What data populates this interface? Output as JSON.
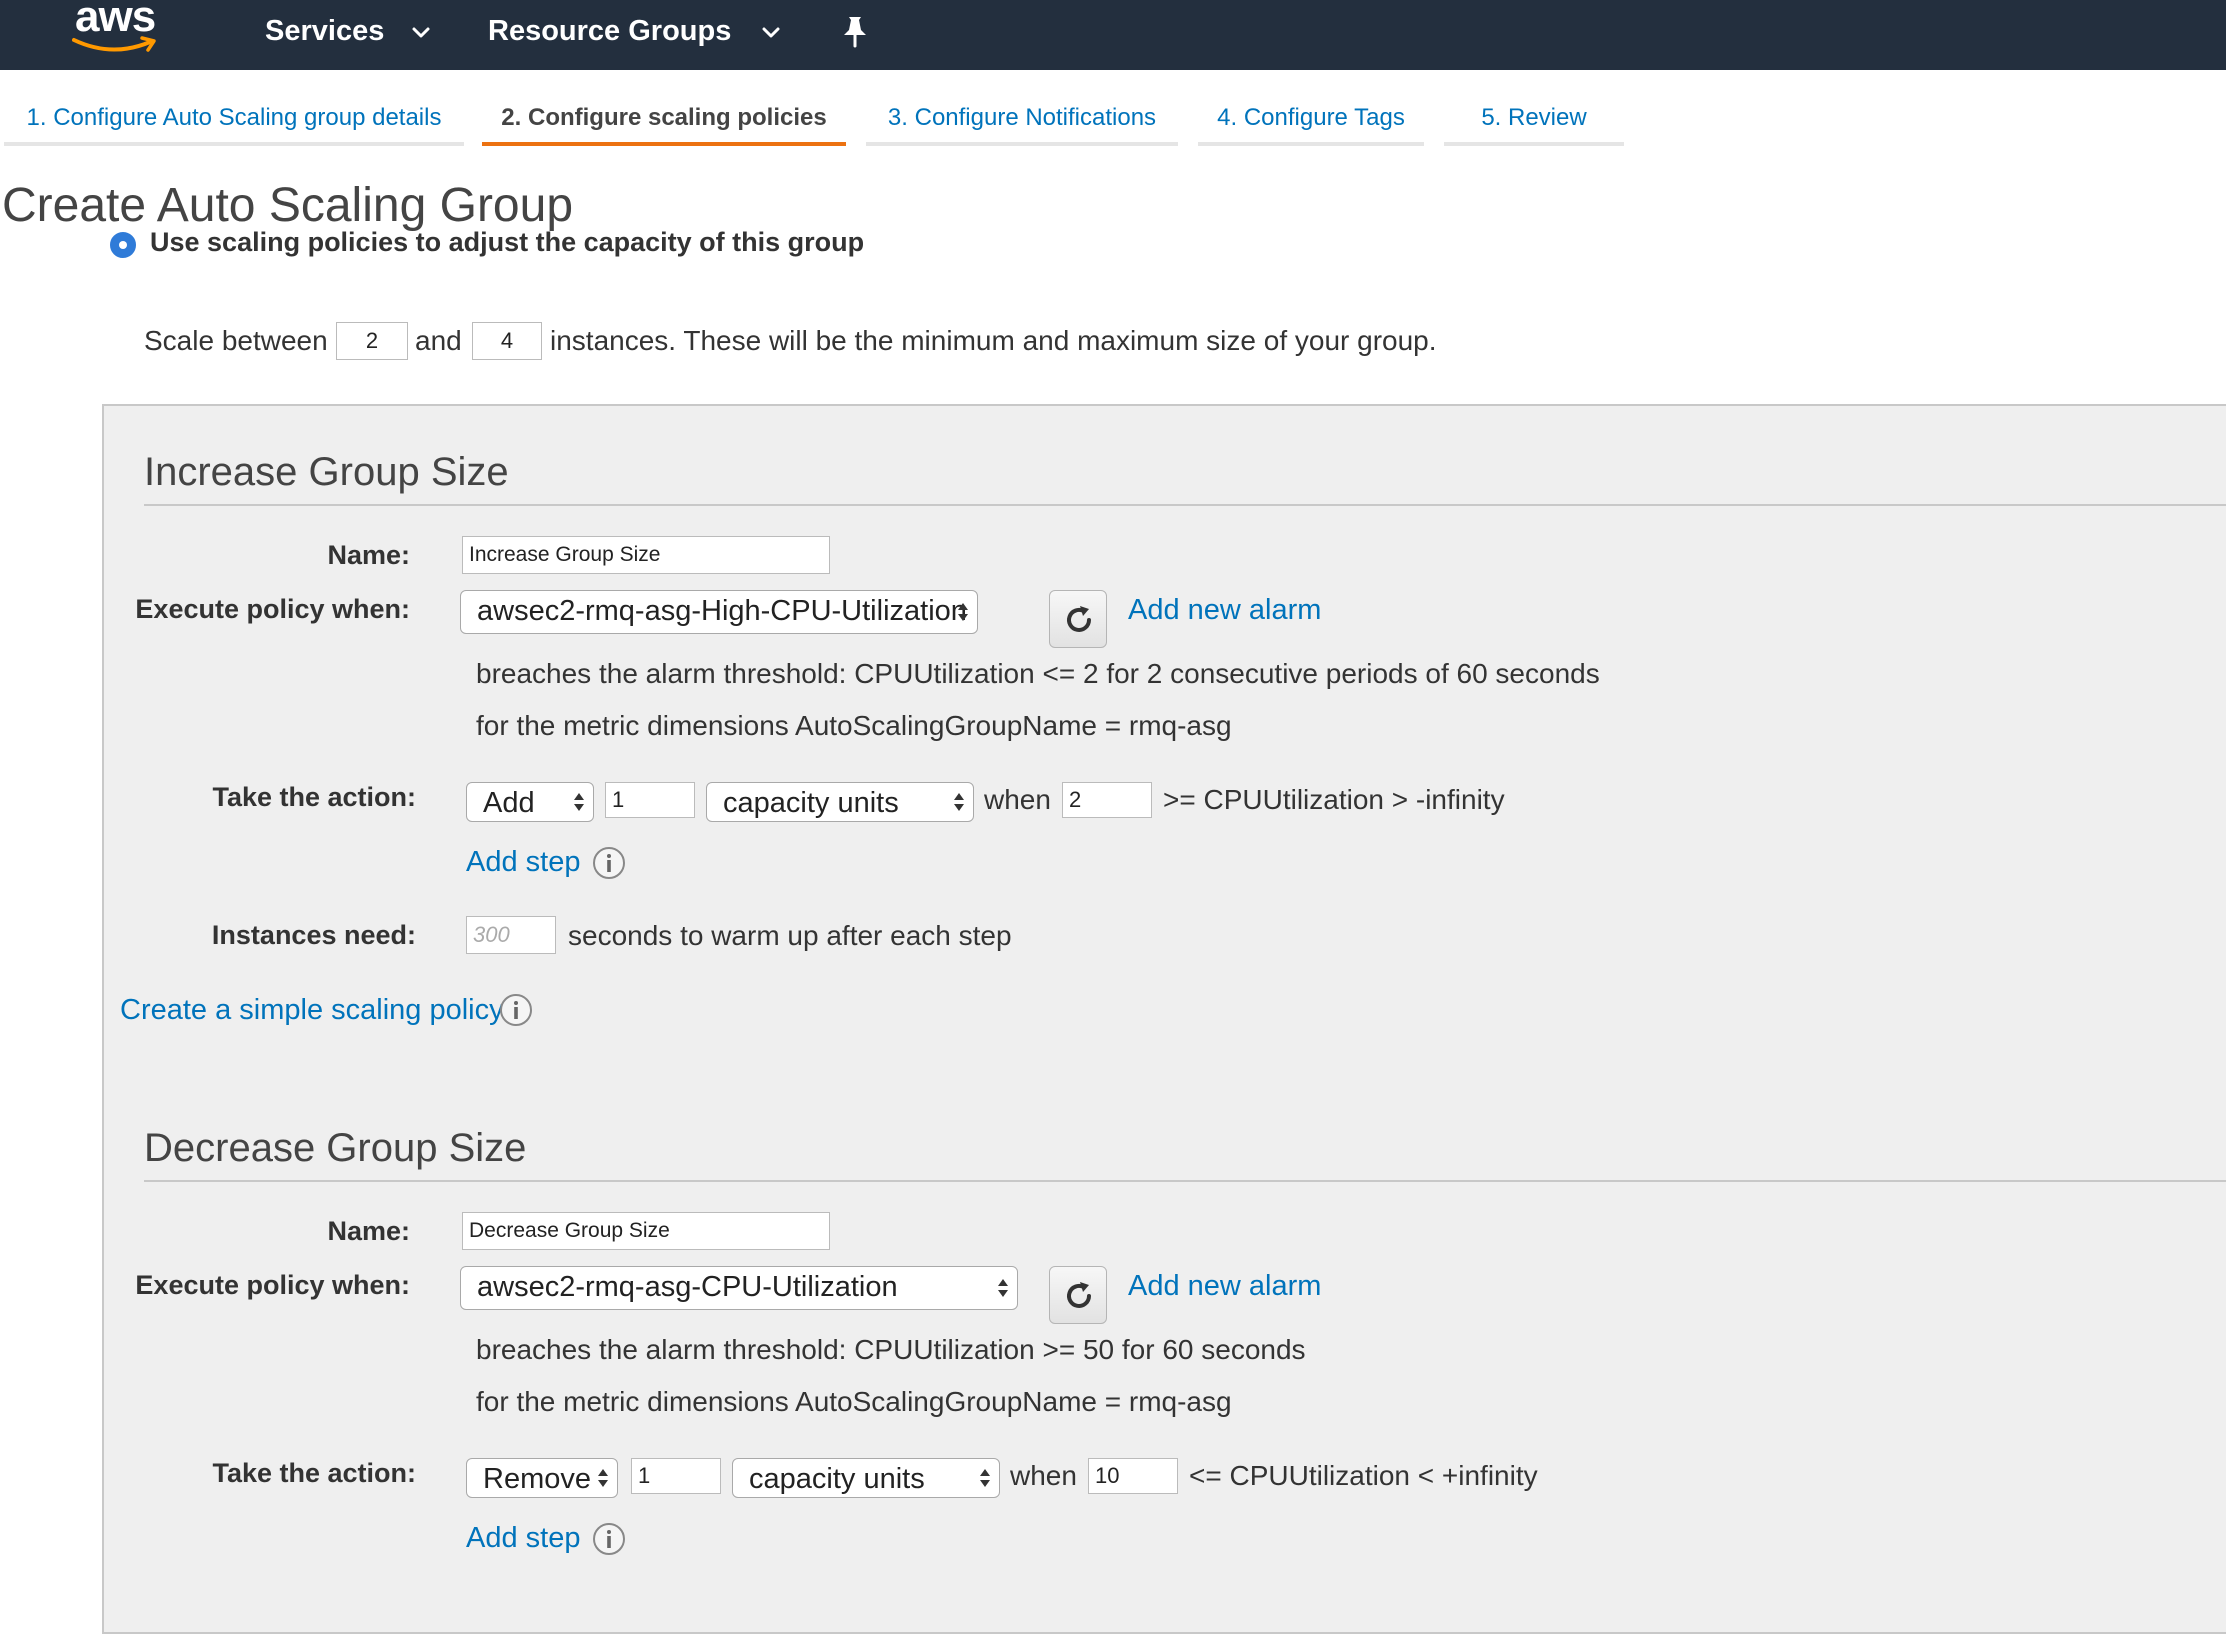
{
  "topnav": {
    "logo": "aws",
    "services": "Services",
    "resource_groups": "Resource Groups",
    "pin_icon": "pin-icon"
  },
  "tabs": [
    {
      "label": "1. Configure Auto Scaling group details",
      "active": false
    },
    {
      "label": "2. Configure scaling policies",
      "active": true
    },
    {
      "label": "3. Configure Notifications",
      "active": false
    },
    {
      "label": "4. Configure Tags",
      "active": false
    },
    {
      "label": "5. Review",
      "active": false
    }
  ],
  "page": {
    "title": "Create Auto Scaling Group",
    "radio_label": "Use scaling policies to adjust the capacity of this group"
  },
  "scale": {
    "prefix": "Scale between",
    "min": "2",
    "and": "and",
    "max": "4",
    "suffix": "instances. These will be the minimum and maximum size of your group."
  },
  "increase": {
    "title": "Increase Group Size",
    "name_label": "Name:",
    "name_value": "Increase Group Size",
    "execute_label": "Execute policy when:",
    "alarm": "awsec2-rmq-asg-High-CPU-Utilization",
    "add_alarm": "Add new alarm",
    "breach": "breaches the alarm threshold: CPUUtilization <= 2 for 2 consecutive periods of 60 seconds",
    "dimensions": "for the metric dimensions AutoScalingGroupName = rmq-asg",
    "action_label": "Take the action:",
    "action": "Add",
    "amount": "1",
    "unit": "capacity units",
    "when": "when",
    "threshold": "2",
    "condition": ">= CPUUtilization > -infinity",
    "add_step": "Add step",
    "instances_label": "Instances need:",
    "warmup_placeholder": "300",
    "warmup_suffix": "seconds to warm up after each step",
    "simple_policy": "Create a simple scaling policy"
  },
  "decrease": {
    "title": "Decrease Group Size",
    "name_label": "Name:",
    "name_value": "Decrease Group Size",
    "execute_label": "Execute policy when:",
    "alarm": "awsec2-rmq-asg-CPU-Utilization",
    "add_alarm": "Add new alarm",
    "breach": "breaches the alarm threshold: CPUUtilization >= 50 for 60 seconds",
    "dimensions": "for the metric dimensions AutoScalingGroupName = rmq-asg",
    "action_label": "Take the action:",
    "action": "Remove",
    "amount": "1",
    "unit": "capacity units",
    "when": "when",
    "threshold": "10",
    "condition": "<= CPUUtilization < +infinity",
    "add_step": "Add step"
  },
  "colors": {
    "nav_bg": "#232f3e",
    "link": "#0073bb",
    "active_tab": "#ec7211",
    "panel_bg": "#efefef"
  }
}
